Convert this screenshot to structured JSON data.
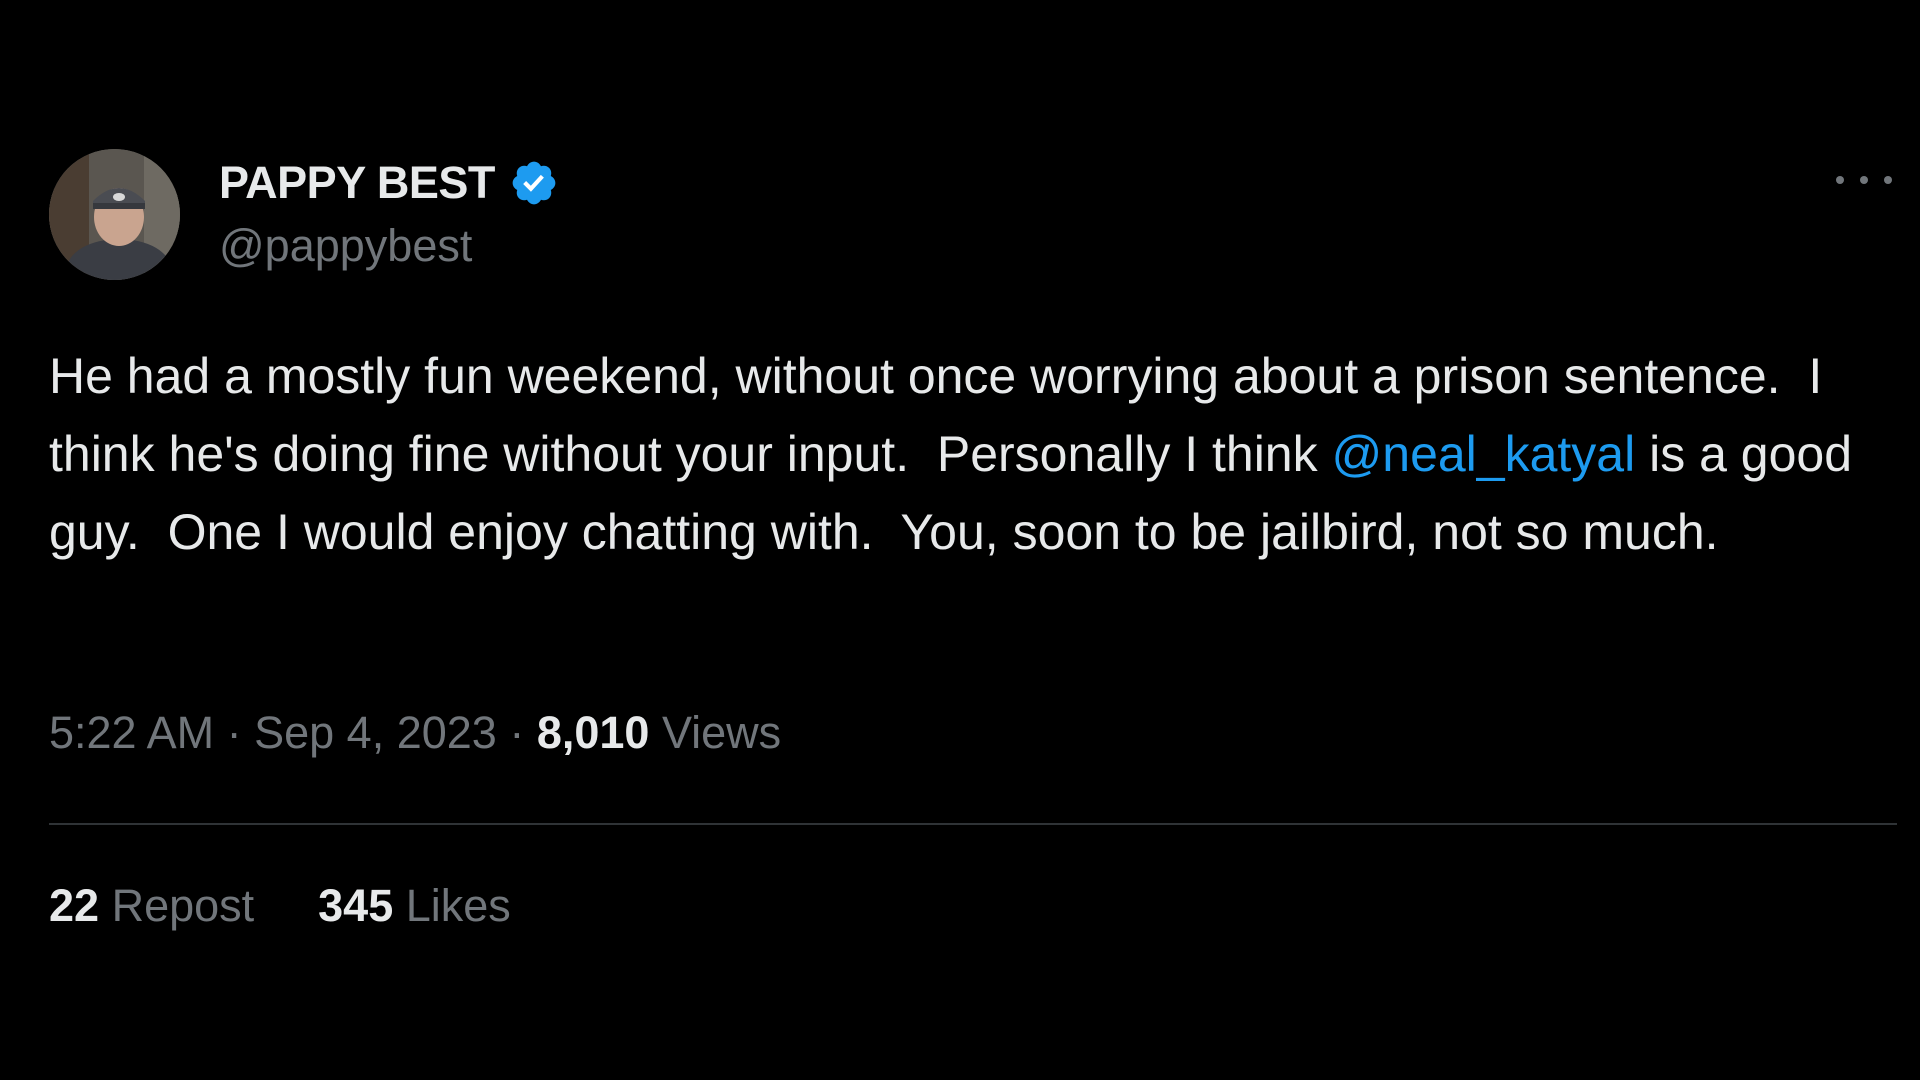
{
  "author": {
    "display_name": "PAPPY BEST",
    "handle": "@pappybest",
    "verified_icon": "verified-badge-icon",
    "avatar_icon": "avatar-photo"
  },
  "more_icon": "more-options-icon",
  "tweet": {
    "text_before": "He had a mostly fun weekend, without once worrying about a prison sentence.  I think he's doing fine without your input.  Personally I think ",
    "mention": "@neal_katyal",
    "text_after": " is a good guy.  One I would enjoy chatting with.  You, soon to be jailbird, not so much."
  },
  "meta": {
    "time": "5:22 AM",
    "separator": " · ",
    "date": "Sep 4, 2023",
    "views_count": "8,010",
    "views_label": " Views"
  },
  "stats": {
    "reposts_count": "22",
    "reposts_label": " Repost",
    "likes_count": "345",
    "likes_label": " Likes"
  },
  "colors": {
    "background": "#000000",
    "text": "#e7e9ea",
    "secondary": "#71767b",
    "accent": "#1d9bf0",
    "divider": "#2f3336"
  }
}
